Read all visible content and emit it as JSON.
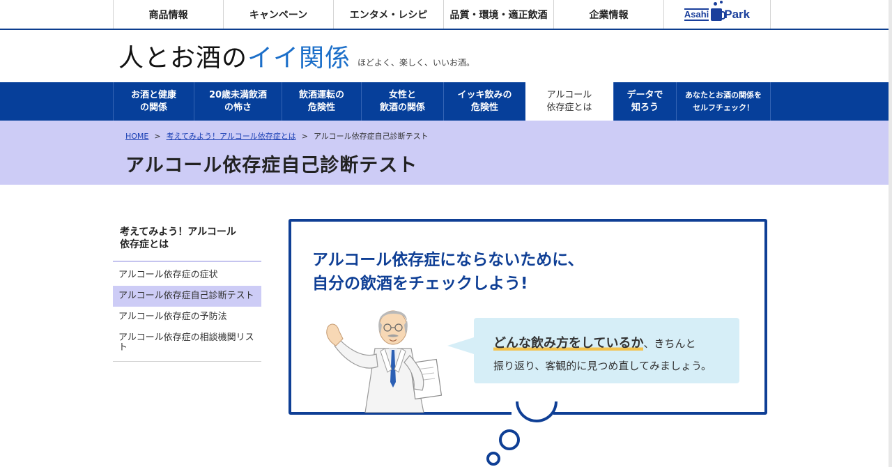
{
  "global_nav": {
    "items": [
      "商品情報",
      "キャンペーン",
      "エンタメ・レシピ",
      "品質・環境・適正飲酒",
      "企業情報"
    ],
    "logo_left": "Asahi",
    "logo_right": "Park"
  },
  "brand": {
    "title_pre": "人とお酒の",
    "title_accent": "イイ関係",
    "subtitle": "ほどよく、楽しく、いいお酒。"
  },
  "category_nav": {
    "items": [
      "お酒と健康\nの関係",
      "20歳未満飲酒\nの怖さ",
      "飲酒運転の\n危険性",
      "女性と\n飲酒の関係",
      "イッキ飲みの\n危険性",
      "アルコール\n依存症とは",
      "データで\n知ろう",
      "あなたとお酒の関係を\nセルフチェック！"
    ],
    "active_index": 5
  },
  "breadcrumb": {
    "home": "HOME",
    "sep": ">",
    "parent": "考えてみよう！アルコール依存症とは",
    "current": "アルコール依存症自己診断テスト"
  },
  "page_title": "アルコール依存症自己診断テスト",
  "sidebar": {
    "heading": "考えてみよう！アルコール\n依存症とは",
    "items": [
      "アルコール依存症の症状",
      "アルコール依存症自己診断テスト",
      "アルコール依存症の予防法",
      "アルコール依存症の相談機関リスト"
    ],
    "active_index": 1
  },
  "visual": {
    "headline_line1": "アルコール依存症にならないために、",
    "headline_line2": "自分の飲酒をチェックしよう!",
    "bubble_emphasis": "どんな飲み方をしているか",
    "bubble_line1_rest": "、きちんと",
    "bubble_line2": "振り返り、客観的に見つめ直してみましょう。"
  },
  "colors": {
    "nav_blue": "#063f9a",
    "band_lavender": "#cdccf6",
    "frame_blue": "#0f3f95",
    "bubble_bg": "#d6eef7",
    "accent_underline": "#f3c34e"
  }
}
